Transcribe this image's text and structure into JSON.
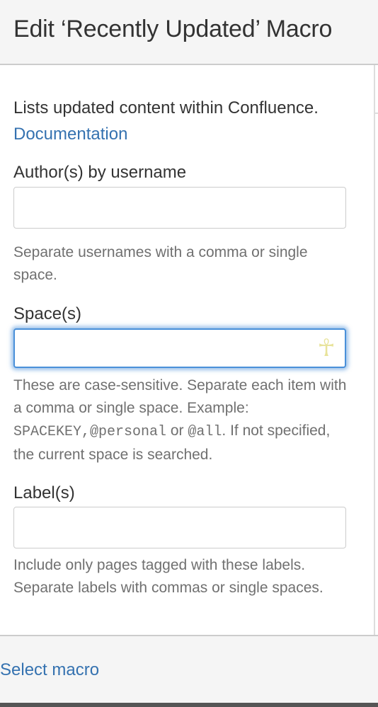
{
  "dialog": {
    "title": "Edit ‘Recently Updated’ Macro"
  },
  "description": {
    "text": "Lists updated content within Confluence.",
    "link": "Documentation"
  },
  "fields": {
    "author": {
      "label": "Author(s) by username",
      "value": "",
      "placeholder": "",
      "help": "Separate usernames with a comma or single space."
    },
    "space": {
      "label": "Space(s)",
      "value": "",
      "placeholder": "",
      "help_part1": "These are case-sensitive. Separate each item with a comma or single space. Example: ",
      "help_code1": "SPACEKEY,@personal",
      "help_part2": " or ",
      "help_code2": "@all",
      "help_part3": ". If not specified, the current space is searched.",
      "icon": "ankh-icon"
    },
    "labels": {
      "label": "Label(s)",
      "value": "",
      "placeholder": "",
      "help": "Include only pages tagged with these labels. Separate labels with commas or single spaces."
    }
  },
  "footer": {
    "select_macro": "Select macro"
  },
  "colors": {
    "link": "#3572b0",
    "focus": "#4a90d9",
    "help_text": "#707070",
    "header_bg": "#f5f5f5"
  }
}
